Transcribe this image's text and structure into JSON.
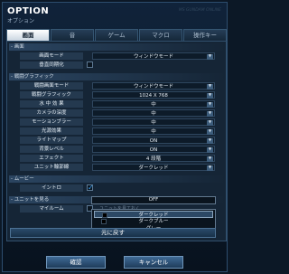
{
  "window": {
    "title": "OPTION",
    "subtitle": "オプション",
    "watermark": "MS GUNDAM ONLINE"
  },
  "tabs": [
    {
      "label": "画面",
      "active": true
    },
    {
      "label": "音",
      "active": false
    },
    {
      "label": "ゲーム",
      "active": false
    },
    {
      "label": "マクロ",
      "active": false
    },
    {
      "label": "操作キー",
      "active": false
    }
  ],
  "sections": {
    "screen": "- 画面",
    "graphics": "- 戦闘グラフィック",
    "movie": "- ムービー",
    "unit": "- ユニットを見る"
  },
  "screen": {
    "mode_label": "画面モード",
    "mode_value": "ウィンドウモード",
    "fix_label": "垂直同期化"
  },
  "graphics": {
    "rows": [
      {
        "label": "戦闘画面モード",
        "value": "ウィンドウモード"
      },
      {
        "label": "戦闘グラフィック",
        "value": "1024 X 768"
      },
      {
        "label": "水 中 効 果",
        "value": "中"
      },
      {
        "label": "カメラの深度",
        "value": "中"
      },
      {
        "label": "モーションブラー",
        "value": "中"
      },
      {
        "label": "光源効果",
        "value": "中"
      },
      {
        "label": "ライトマップ",
        "value": "ON"
      },
      {
        "label": "背景レベル",
        "value": "ON"
      },
      {
        "label": "エフェクト",
        "value": "4 段階"
      },
      {
        "label": "ユニット輪郭線",
        "value": "ダークレッド"
      }
    ]
  },
  "movie": {
    "intro_label": "イントロ",
    "intro_checked": true
  },
  "unit": {
    "room_label": "マイルーム",
    "room_note": "ユニットを見ておく"
  },
  "dropdown": {
    "head": "OFF",
    "options": [
      "ダークレッド",
      "ダークブルー",
      "グレー"
    ],
    "selected_index": 0
  },
  "buttons": {
    "reset": "元に戻す",
    "confirm": "確認",
    "cancel": "キャンセル"
  },
  "colors": {
    "background": "#0c1826",
    "active_tab": "#ffffff",
    "accent": "#3aa8ff"
  }
}
